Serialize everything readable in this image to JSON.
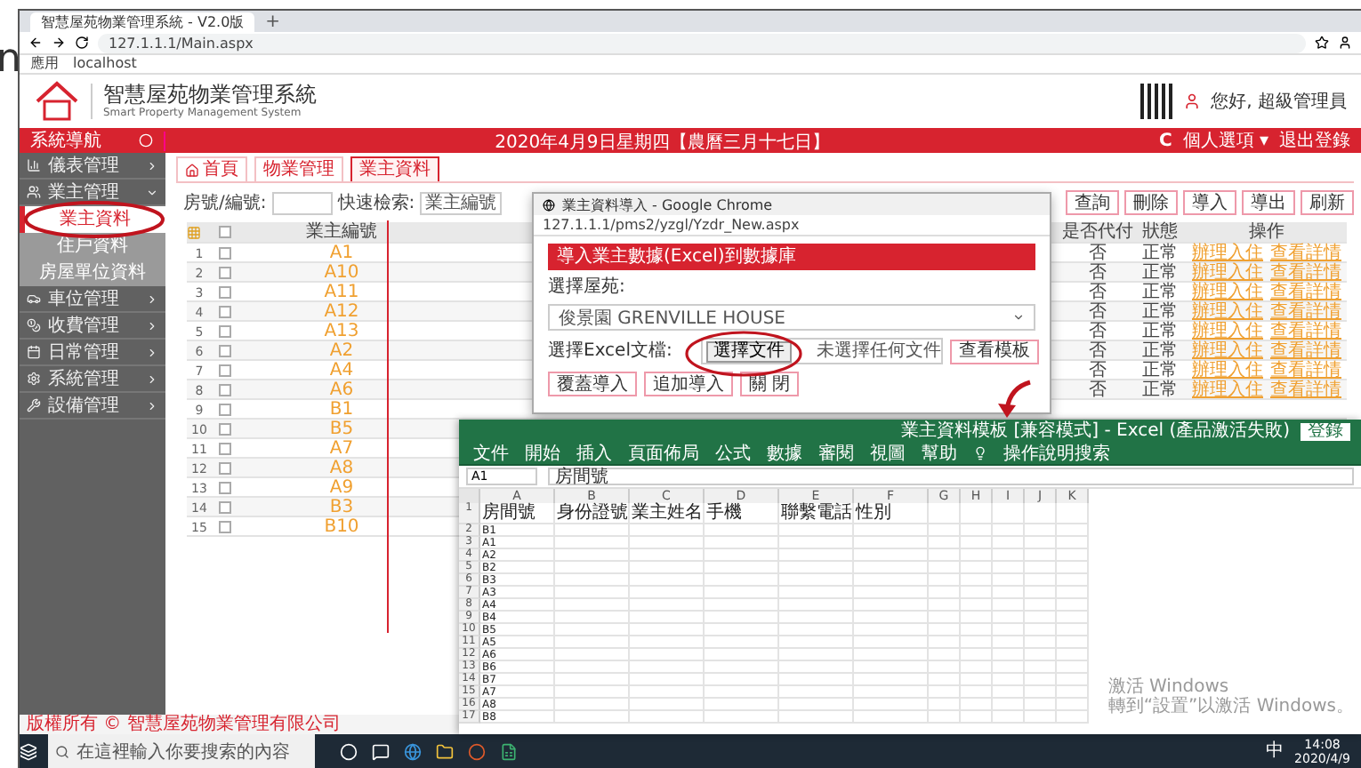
{
  "stray_text": "n",
  "browser": {
    "tab_title": "智慧屋苑物業管理系統 - V2.0版",
    "new_tab": "+",
    "url": "127.1.1.1/Main.aspx",
    "bookmarks": [
      "應用",
      "localhost"
    ]
  },
  "header": {
    "title": "智慧屋苑物業管理系統",
    "subtitle": "Smart Property Management System",
    "user": "您好, 超級管理員"
  },
  "topbar": {
    "nav_title": "系統導航",
    "date": "2020年4月9日星期四【農曆三月十七日】",
    "refresh": "C",
    "options": "個人選項 ▾",
    "logout": "退出登錄"
  },
  "sidebar": [
    {
      "label": "儀表管理",
      "expanded": false
    },
    {
      "label": "業主管理",
      "expanded": true,
      "children": [
        {
          "label": "業主資料",
          "selected": true
        },
        {
          "label": "住戶資料",
          "selected": false
        },
        {
          "label": "房屋單位資料",
          "selected": false
        }
      ]
    },
    {
      "label": "車位管理",
      "expanded": false
    },
    {
      "label": "收費管理",
      "expanded": false
    },
    {
      "label": "日常管理",
      "expanded": false
    },
    {
      "label": "系統管理",
      "expanded": false
    },
    {
      "label": "設備管理",
      "expanded": false
    }
  ],
  "content_tabs": [
    {
      "label": "首頁",
      "selected": false
    },
    {
      "label": "物業管理",
      "selected": false
    },
    {
      "label": "業主資料",
      "selected": true
    }
  ],
  "filter": {
    "room_label": "房號/編號:",
    "search_label": "快速檢索:",
    "search_value": "業主編號"
  },
  "toolbar_buttons": [
    "查詢",
    "刪除",
    "導入",
    "導出",
    "刷新"
  ],
  "table": {
    "all_checked": false,
    "columns": [
      "業主編號",
      "是否代付",
      "狀態",
      "操作"
    ],
    "rows": [
      {
        "no": "1",
        "checked": false,
        "code": "A1",
        "paid": "否",
        "status": "正常",
        "actions": [
          "辦理入住",
          "查看詳情"
        ]
      },
      {
        "no": "2",
        "checked": false,
        "code": "A10",
        "paid": "否",
        "status": "正常",
        "actions": [
          "辦理入住",
          "查看詳情"
        ]
      },
      {
        "no": "3",
        "checked": false,
        "code": "A11",
        "paid": "否",
        "status": "正常",
        "actions": [
          "辦理入住",
          "查看詳情"
        ]
      },
      {
        "no": "4",
        "checked": false,
        "code": "A12",
        "paid": "否",
        "status": "正常",
        "actions": [
          "辦理入住",
          "查看詳情"
        ]
      },
      {
        "no": "5",
        "checked": false,
        "code": "A13",
        "paid": "否",
        "status": "正常",
        "actions": [
          "辦理入住",
          "查看詳情"
        ]
      },
      {
        "no": "6",
        "checked": false,
        "code": "A2",
        "paid": "否",
        "status": "正常",
        "actions": [
          "辦理入住",
          "查看詳情"
        ]
      },
      {
        "no": "7",
        "checked": false,
        "code": "A4",
        "paid": "否",
        "status": "正常",
        "actions": [
          "辦理入住",
          "查看詳情"
        ]
      },
      {
        "no": "8",
        "checked": false,
        "code": "A6",
        "paid": "否",
        "status": "正常",
        "actions": [
          "辦理入住",
          "查看詳情"
        ]
      },
      {
        "no": "9",
        "checked": false,
        "code": "B1"
      },
      {
        "no": "10",
        "checked": false,
        "code": "B5"
      },
      {
        "no": "11",
        "checked": false,
        "code": "A7"
      },
      {
        "no": "12",
        "checked": false,
        "code": "A8"
      },
      {
        "no": "13",
        "checked": false,
        "code": "A9"
      },
      {
        "no": "14",
        "checked": false,
        "code": "B3"
      },
      {
        "no": "15",
        "checked": false,
        "code": "B10"
      }
    ]
  },
  "popup": {
    "title": "業主資料導入 - Google Chrome",
    "url": "127.1.1.1/pms2/yzgl/Yzdr_New.aspx",
    "heading": "導入業主數據(Excel)到數據庫",
    "estate_label": "選擇屋苑:",
    "estate_value": "俊景園 GRENVILLE HOUSE",
    "file_label": "選擇Excel文檔:",
    "file_button": "選擇文件",
    "file_status": "未選擇任何文件",
    "template_button": "查看模板",
    "actions": [
      "覆蓋導入",
      "追加導入",
      "關 閉"
    ]
  },
  "excel": {
    "title": "業主資料模板 [兼容模式] - Excel (產品激活失敗)",
    "login": "登錄",
    "ribbon": [
      "文件",
      "開始",
      "插入",
      "頁面佈局",
      "公式",
      "數據",
      "審閱",
      "視圖",
      "幫助"
    ],
    "tell_me": "操作說明搜索",
    "name_box": "A1",
    "formula": "房間號",
    "columns": [
      "A",
      "B",
      "C",
      "D",
      "E",
      "F",
      "G",
      "H",
      "I",
      "J",
      "K"
    ],
    "rows": [
      {
        "num": "1",
        "cells": [
          "房間號",
          "身份證號",
          "業主姓名",
          "手機",
          "聯繫電話",
          "性別"
        ]
      },
      {
        "num": "2",
        "cells": [
          "B1"
        ]
      },
      {
        "num": "3",
        "cells": [
          "A1"
        ]
      },
      {
        "num": "4",
        "cells": [
          "A2"
        ]
      },
      {
        "num": "5",
        "cells": [
          "B2"
        ]
      },
      {
        "num": "6",
        "cells": [
          "B3"
        ]
      },
      {
        "num": "7",
        "cells": [
          "A3"
        ]
      },
      {
        "num": "8",
        "cells": [
          "A4"
        ]
      },
      {
        "num": "9",
        "cells": [
          "B4"
        ]
      },
      {
        "num": "10",
        "cells": [
          "B5"
        ]
      },
      {
        "num": "11",
        "cells": [
          "A5"
        ]
      },
      {
        "num": "12",
        "cells": [
          "A6"
        ]
      },
      {
        "num": "13",
        "cells": [
          "B6"
        ]
      },
      {
        "num": "14",
        "cells": [
          "B7"
        ]
      },
      {
        "num": "15",
        "cells": [
          "A7"
        ]
      },
      {
        "num": "16",
        "cells": [
          "A8"
        ]
      },
      {
        "num": "17",
        "cells": [
          "B8"
        ]
      }
    ],
    "activation": [
      "激活 Windows",
      "轉到“設置”以激活 Windows。"
    ]
  },
  "footer": "版權所有 © 智慧屋苑物業管理有限公司",
  "taskbar": {
    "search_placeholder": "在這裡輸入你要搜索的內容",
    "ime": "中",
    "time": "14:08",
    "date": "2020/4/9"
  }
}
